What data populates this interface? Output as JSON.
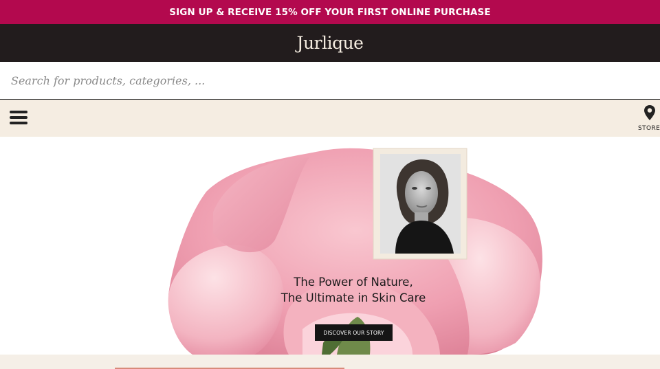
{
  "promo": {
    "text": "SIGN UP & RECEIVE 15% OFF YOUR FIRST ONLINE PURCHASE"
  },
  "header": {
    "logo_text": "Jurlique"
  },
  "search": {
    "placeholder": "Search for products, categories, ...",
    "value": ""
  },
  "nav": {
    "menu_icon": "hamburger-icon",
    "store_icon": "map-pin-icon",
    "store_label": "STORE"
  },
  "hero": {
    "headline_line1": "The Power of Nature,",
    "headline_line2": "The Ultimate in Skin Care",
    "cta_label": "DISCOVER OUR STORY"
  },
  "colors": {
    "promo_bg": "#b3094e",
    "header_bg": "#221c1d",
    "nav_bg": "#f5ede2",
    "rose": "#f0a3b3",
    "cta_bg": "#151515"
  }
}
